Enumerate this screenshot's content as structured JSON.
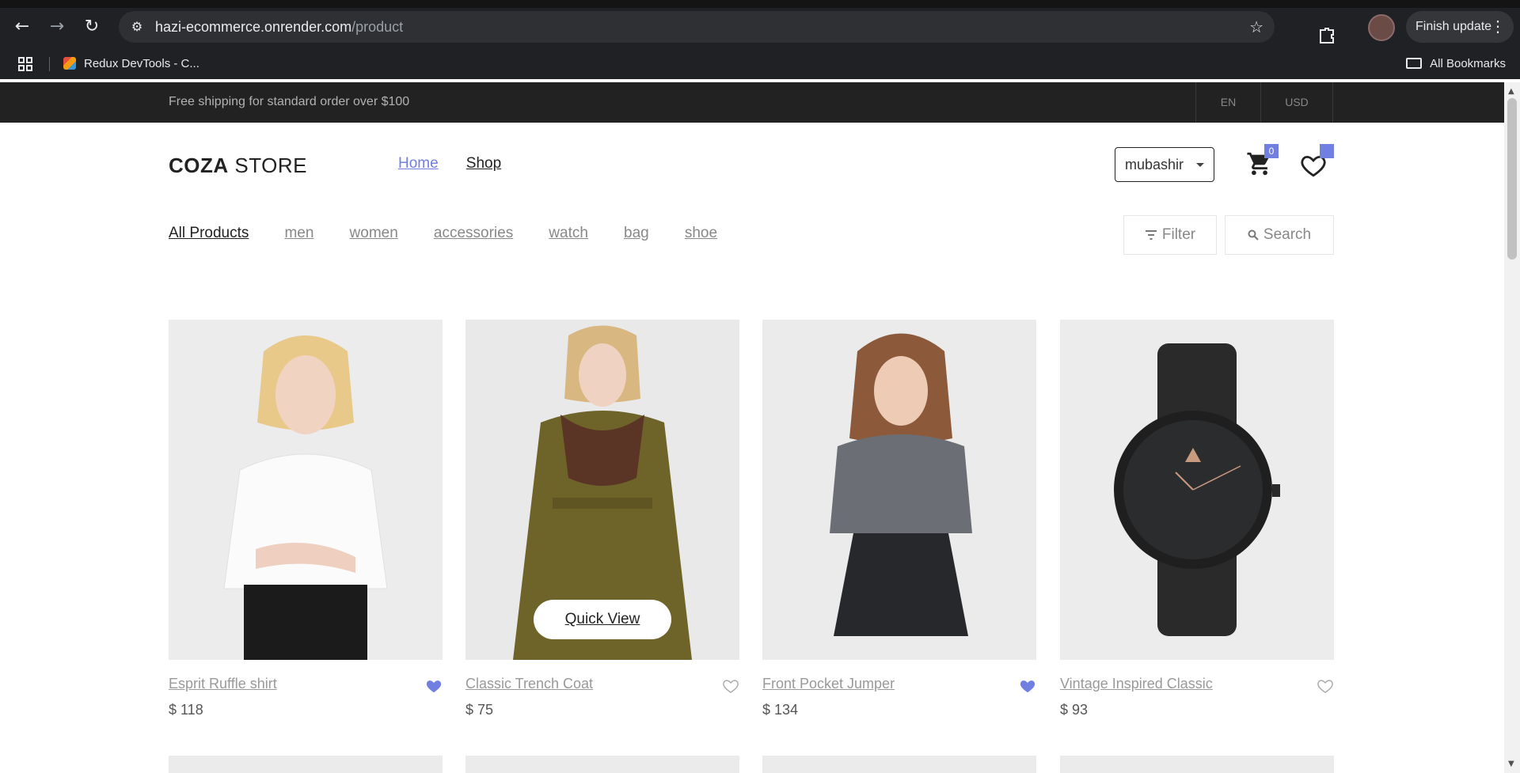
{
  "browser": {
    "url_host": "hazi-ecommerce.onrender.com",
    "url_path": "/product",
    "finish_update_label": "Finish update",
    "bookmark_item": "Redux DevTools - C...",
    "all_bookmarks_label": "All Bookmarks"
  },
  "topbar": {
    "shipping_text": "Free shipping for standard order over $100",
    "language": "EN",
    "currency": "USD"
  },
  "header": {
    "logo_bold": "COZA",
    "logo_light": " STORE",
    "nav": {
      "home": "Home",
      "shop": "Shop"
    },
    "user": "mubashir",
    "cart_count": "0"
  },
  "categories": [
    "All Products",
    "men",
    "women",
    "accessories",
    "watch",
    "bag",
    "shoe"
  ],
  "toolbar": {
    "filter_label": "Filter",
    "search_label": "Search"
  },
  "quick_view_label": "Quick View",
  "products": [
    {
      "name": "Esprit Ruffle shirt",
      "price": "$ 118",
      "favorited": true
    },
    {
      "name": "Classic Trench Coat",
      "price": "$ 75",
      "favorited": false
    },
    {
      "name": "Front Pocket Jumper",
      "price": "$ 134",
      "favorited": true
    },
    {
      "name": "Vintage Inspired Classic",
      "price": "$ 93",
      "favorited": false
    }
  ],
  "colors": {
    "accent": "#717fe0",
    "topbar": "#222222"
  }
}
